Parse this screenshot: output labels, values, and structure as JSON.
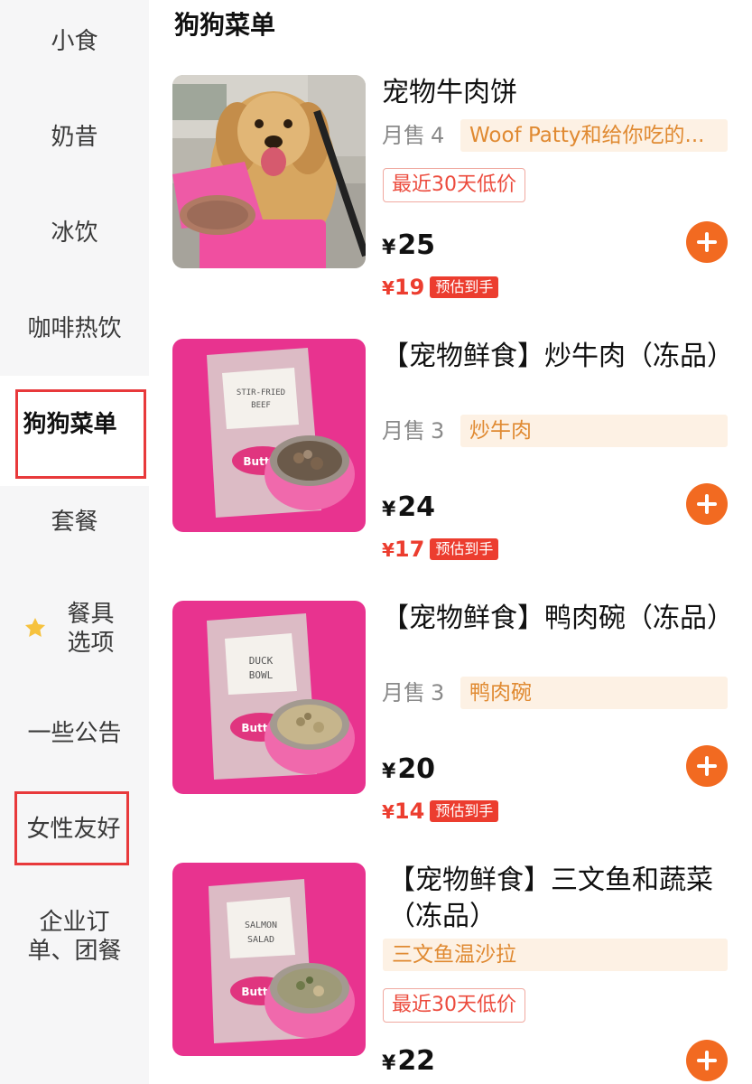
{
  "sidebar": {
    "items": [
      {
        "label": "小食"
      },
      {
        "label": "奶昔"
      },
      {
        "label": "冰饮"
      },
      {
        "label": "咖啡热饮"
      },
      {
        "label": "狗狗菜单"
      },
      {
        "label": "套餐"
      },
      {
        "label_line1": "餐具",
        "label_line2": "选项"
      },
      {
        "label": "一些公告"
      },
      {
        "label": "女性友好"
      },
      {
        "label_line1": "企业订",
        "label_line2": "单、团餐"
      }
    ],
    "active_index": 4,
    "highlight_color": "#e8393b"
  },
  "section": {
    "title": "狗狗菜单"
  },
  "currency": "¥",
  "est_label": "预估到手",
  "sales_label": "月售",
  "low_price_tag": "最近30天低价",
  "products": [
    {
      "name": "宠物牛肉饼",
      "sales": "4",
      "desc": "Woof Patty和给你吃的...",
      "tag": "最近30天低价",
      "price": "25",
      "est_price": "19",
      "thumb": "golden-retriever-photo"
    },
    {
      "name": "【宠物鲜食】炒牛肉（冻品）",
      "sales": "3",
      "desc": "炒牛肉",
      "price": "24",
      "est_price": "17",
      "thumb": "pink-package-bowl"
    },
    {
      "name": "【宠物鲜食】鸭肉碗（冻品）",
      "sales": "3",
      "desc": "鸭肉碗",
      "price": "20",
      "est_price": "14",
      "thumb": "pink-package-bowl"
    },
    {
      "name": "【宠物鲜食】三文鱼和蔬菜（冻品）",
      "desc": "三文鱼温沙拉",
      "tag": "最近30天低价",
      "price": "22",
      "thumb": "pink-package-bowl"
    }
  ],
  "colors": {
    "accent_orange": "#f26a21",
    "price_red": "#ec3d2f",
    "desc_bg": "#fdf1e4",
    "desc_text": "#e08a32",
    "thumb_pink": "#e8338f"
  }
}
